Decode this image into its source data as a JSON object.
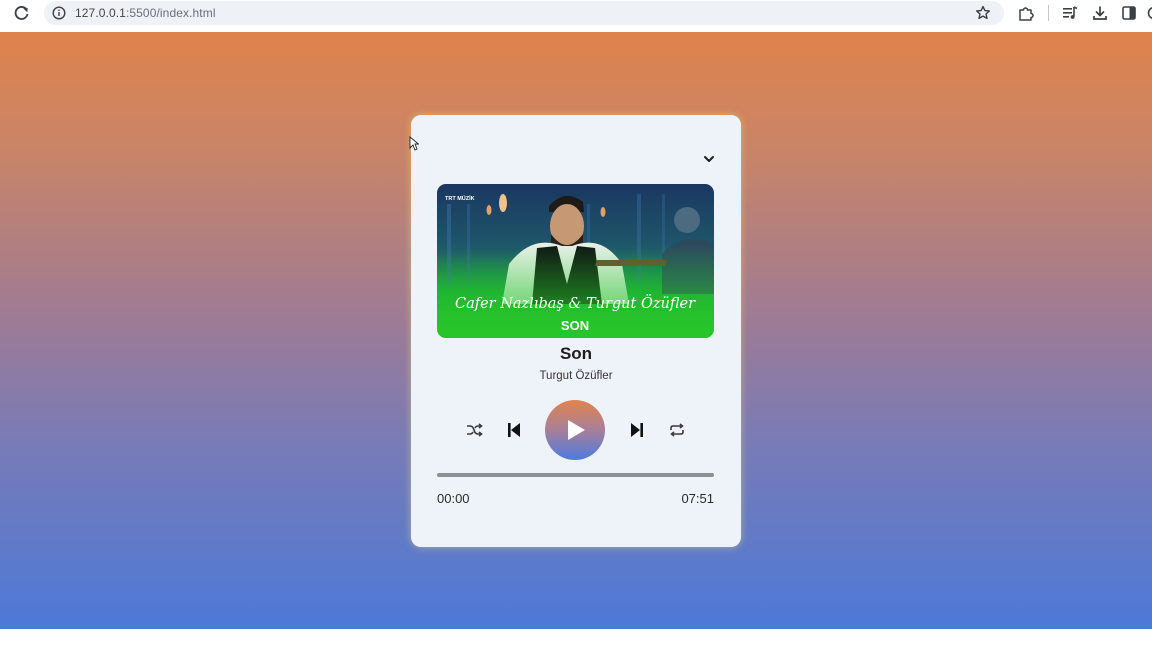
{
  "browser": {
    "url_host": "127.0.0.1",
    "url_rest": ":5500/index.html"
  },
  "player": {
    "song_title": "Son",
    "artist": "Turgut Özüfler",
    "current_time": "00:00",
    "duration": "07:51",
    "progress_fraction": 0,
    "cover": {
      "overlay_text": "Cafer Nazlıbaş & Turgut Özüfler",
      "song_text": "SON",
      "channel_logo": "TRT MÜZİK"
    }
  },
  "colors": {
    "gradient_top": "#df834c",
    "gradient_bottom": "#4c79d8",
    "card_bg": "#eef3f9"
  },
  "icons": {
    "reload": "reload-icon",
    "info": "info-icon",
    "bookmark": "star-icon",
    "extensions": "puzzle-icon",
    "media": "media-control-icon",
    "downloads": "download-icon",
    "side_panel": "side-panel-icon",
    "collapse": "chevron-down-icon",
    "shuffle": "shuffle-icon",
    "previous": "skip-previous-icon",
    "play": "play-icon",
    "next": "skip-next-icon",
    "repeat": "repeat-icon"
  }
}
